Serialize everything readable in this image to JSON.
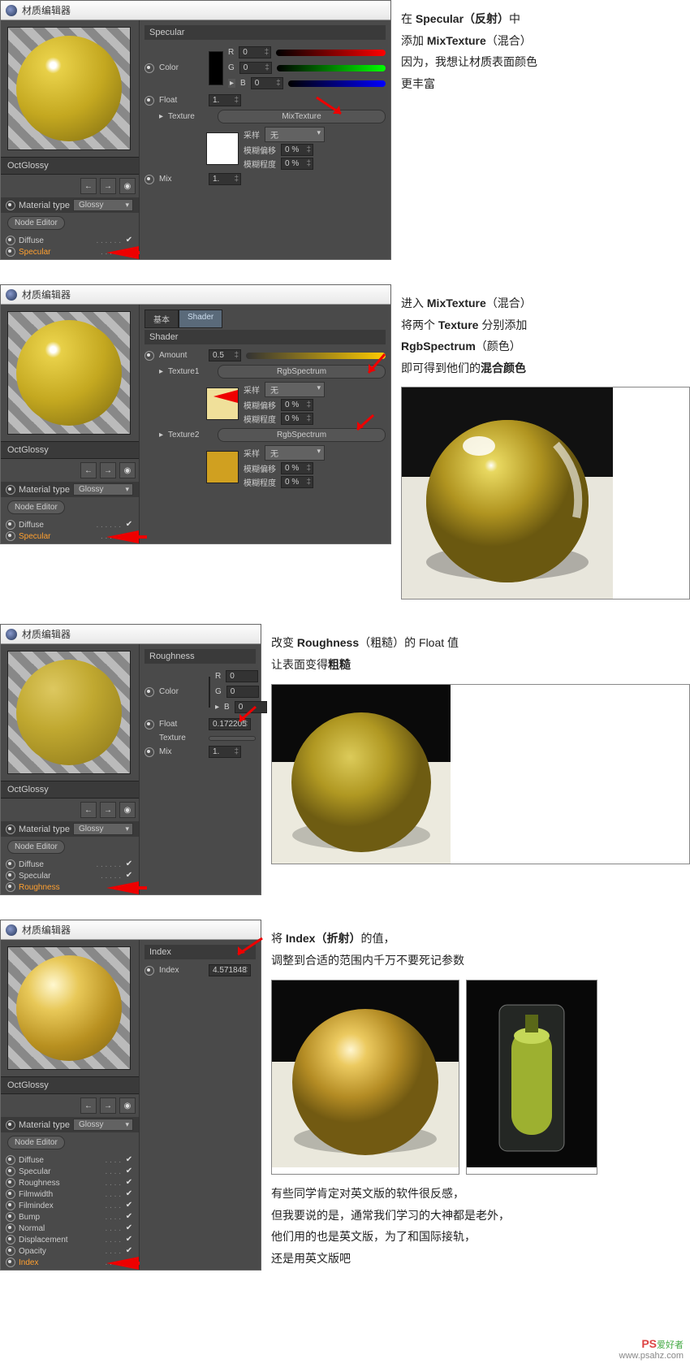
{
  "common": {
    "window_title": "材质编辑器",
    "mat_name": "OctGlossy",
    "mat_type_label": "Material type",
    "mat_type_value": "Glossy",
    "node_editor": "Node Editor",
    "sample": "采样",
    "sample_val": "无",
    "blur_offset": "模糊偏移",
    "blur_degree": "模糊程度",
    "pct0": "0 %"
  },
  "p1": {
    "channels": [
      {
        "name": "Diffuse",
        "hl": false
      },
      {
        "name": "Specular",
        "hl": true
      }
    ],
    "header": "Specular",
    "color_label": "Color",
    "r": "R",
    "g": "G",
    "b": "B",
    "rv": "0",
    "gv": "0",
    "bv": "0",
    "float_label": "Float",
    "float_val": "1.",
    "texture_label": "Texture",
    "texture_btn": "MixTexture",
    "mix_label": "Mix",
    "mix_val": "1."
  },
  "note1": {
    "l1a": "在 ",
    "l1b": "Specular（反射）",
    "l1c": "中",
    "l2a": "添加 ",
    "l2b": "MixTexture",
    "l2c": "（混合）",
    "l3": "因为，我想让材质表面颜色",
    "l4": "更丰富"
  },
  "p2": {
    "tab_basic": "基本",
    "tab_shader": "Shader",
    "header": "Shader",
    "amount_label": "Amount",
    "amount_val": "0.5",
    "tex1_label": "Texture1",
    "tex2_label": "Texture2",
    "tex_btn": "RgbSpectrum",
    "channels": [
      {
        "name": "Diffuse",
        "hl": false
      },
      {
        "name": "Specular",
        "hl": true
      }
    ]
  },
  "note2": {
    "l1a": "进入 ",
    "l1b": "MixTexture",
    "l1c": "（混合）",
    "l2a": "将两个 ",
    "l2b": "Texture",
    "l2c": " 分别添加",
    "l3a": "RgbSpectrum",
    "l3b": "（颜色）",
    "l4a": "即可得到他们的",
    "l4b": "混合颜色"
  },
  "p3": {
    "channels": [
      {
        "name": "Diffuse",
        "hl": false
      },
      {
        "name": "Specular",
        "hl": false
      },
      {
        "name": "Roughness",
        "hl": true
      }
    ],
    "header": "Roughness",
    "color_label": "Color",
    "r": "R",
    "g": "G",
    "b": "B",
    "rv": "0",
    "gv": "0",
    "bv": "0",
    "float_label": "Float",
    "float_val": "0.172205",
    "texture_label": "Texture",
    "mix_label": "Mix",
    "mix_val": "1."
  },
  "note3": {
    "l1a": "改变 ",
    "l1b": "Roughness",
    "l1c": "（粗糙）的 Float 值",
    "l2a": "让表面变得",
    "l2b": "粗糙"
  },
  "p4": {
    "channels": [
      {
        "name": "Diffuse",
        "hl": false
      },
      {
        "name": "Specular",
        "hl": false
      },
      {
        "name": "Roughness",
        "hl": false
      },
      {
        "name": "Filmwidth",
        "hl": false
      },
      {
        "name": "Filmindex",
        "hl": false
      },
      {
        "name": "Bump",
        "hl": false
      },
      {
        "name": "Normal",
        "hl": false
      },
      {
        "name": "Displacement",
        "hl": false
      },
      {
        "name": "Opacity",
        "hl": false
      },
      {
        "name": "Index",
        "hl": true
      }
    ],
    "header": "Index",
    "index_label": "Index",
    "index_val": "4.571848"
  },
  "note4": {
    "l1a": "将 ",
    "l1b": "Index（折射）",
    "l1c": "的值，",
    "l2": "调整到合适的范围内千万不要死记参数",
    "l3": "有些同学肯定对英文版的软件很反感，",
    "l4": "但我要说的是，通常我们学习的大神都是老外，",
    "l5": "他们用的也是英文版，为了和国际接轨，",
    "l6": "还是用英文版吧"
  },
  "watermark": {
    "logo": "PS",
    "txt": "爱好者",
    "url": "www.psahz.com"
  }
}
